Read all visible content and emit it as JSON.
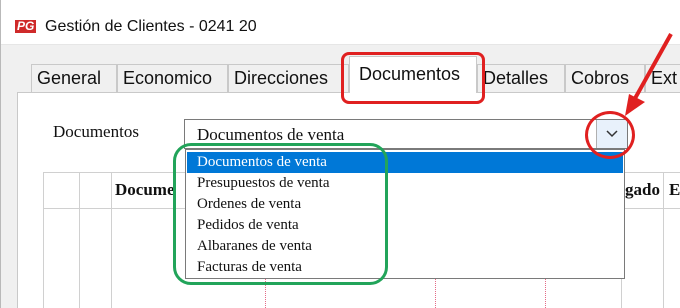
{
  "window": {
    "app_icon_text": "PG",
    "title": "Gestión de Clientes - 0241 20"
  },
  "tabs": [
    {
      "label": "General"
    },
    {
      "label": "Economico"
    },
    {
      "label": "Direcciones"
    },
    {
      "label": "Documentos",
      "active": true
    },
    {
      "label": "Detalles"
    },
    {
      "label": "Cobros"
    },
    {
      "label": "Ext"
    }
  ],
  "documents_field": {
    "label": "Documentos",
    "selected_value": "Documentos de venta",
    "options": [
      "Documentos de venta",
      "Presupuestos de venta",
      "Ordenes de venta",
      "Pedidos de venta",
      "Albaranes de venta",
      "Facturas de venta"
    ]
  },
  "grid": {
    "headers_visible": [
      "Docume",
      "gado",
      "E"
    ]
  },
  "colors": {
    "selection": "#0078d7",
    "annotation_red": "#e02020",
    "annotation_green": "#22a45a"
  },
  "icons": {
    "app": "pg-app-icon",
    "dropdown_arrow": "chevron-down-icon"
  }
}
